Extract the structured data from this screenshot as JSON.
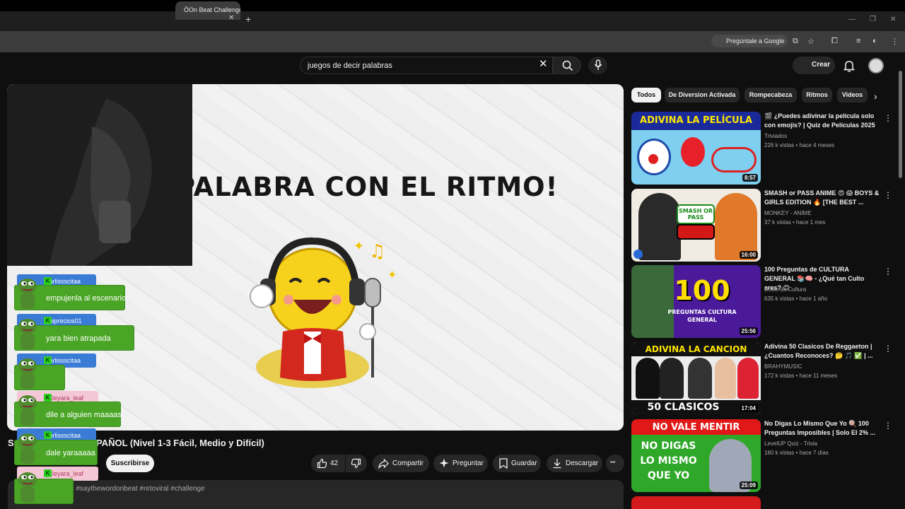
{
  "browser": {
    "tab_title": "ÖOn Beat Challenge",
    "tab_close": "✕",
    "new_tab": "+",
    "google_pill": "Pregúntale a Google"
  },
  "header": {
    "search_query": "juegos de decir palabras",
    "clear": "✕",
    "create_label": "Crear",
    "create_plus": "+"
  },
  "video": {
    "overlay_title": "¡DI LA PALABRA CON EL RITMO!",
    "title_visible": "S                     t Challenge EN ESPAÑOL (Nivel 1-3 Fácil, Medio y Difícil)",
    "subscribe_label": "Suscribirse",
    "likes": "42",
    "share_label": "Compartir",
    "ask_label": "Preguntar",
    "save_label": "Guardar",
    "download_label": "Descargar",
    "more": "•••",
    "description_tags": "as  #saythewordonbeat #retoviral #challenge"
  },
  "chat": [
    {
      "user": "karlissscitaa",
      "message": "empujenla al escenario",
      "name_color": "#3a7bd5",
      "name_text": "#ffffff"
    },
    {
      "user": "chiprecios01",
      "message": "yara bien atrapada",
      "name_color": "#3a7bd5",
      "name_text": "#ffffff"
    },
    {
      "user": "karlissscitaa",
      "message": "",
      "name_color": "#3a7bd5",
      "name_text": "#ffffff"
    },
    {
      "user": "littleyara_leaf",
      "message": "dile a alguien maaaas",
      "name_color": "#f4c7d6",
      "name_text": "#b04060"
    },
    {
      "user": "karlissscitaa",
      "message": "dale yaraaaaa",
      "name_color": "#3a7bd5",
      "name_text": "#ffffff"
    },
    {
      "user": "littleyara_leaf",
      "message": "",
      "name_color": "#f4c7d6",
      "name_text": "#b04060"
    }
  ],
  "chips": [
    "Todos",
    "De Diversion Activada",
    "Rompecabeza",
    "Ritmos",
    "Videos"
  ],
  "chip_next": "›",
  "recommendations": [
    {
      "title": "🎬 ¿Puedes adivinar la película solo con emojis? | Quiz de Películas 2025",
      "channel": "Triviados",
      "meta": "226 k vistas • hace 4 meses",
      "duration": "8:57",
      "thumb_text": "ADIVINA LA PELÍCULA"
    },
    {
      "title": "SMASH or PASS ANIME 😍 😱 BOYS & GIRLS EDITION 🔥 [THE BEST ...",
      "channel": "MONKEY - ANIME",
      "meta": "37 k vistas • hace 1 mes",
      "duration": "16:00",
      "thumb_text": "SMASH OR PASS"
    },
    {
      "title": "100 Preguntas de CULTURA GENERAL 📚🧠 - ¿Qué tan Culto eres? 😊",
      "channel": "Dosis de Cultura",
      "meta": "635 k vistas • hace 1 año",
      "duration": "25:56",
      "thumb_text": "100",
      "thumb_sub": "PREGUNTAS CULTURA GENERAL"
    },
    {
      "title": "Adivina 50 Clasicos De Reggaeton | ¿Cuantos Reconoces? 🤔 🎵 ✅ | ...",
      "channel": "BRAHYMUSIC",
      "meta": "172 k vistas • hace 11 meses",
      "duration": "17:04",
      "thumb_text": "ADIVINA LA CANCION",
      "thumb_sub": "50 CLASICOS"
    },
    {
      "title": "No Digas Lo Mismo Que Yo 🍭 100 Preguntas Imposibles | Solo El 2% ...",
      "channel": "LevelUP Quiz - Trivia",
      "meta": "160 k vistas • hace 7 días",
      "duration": "25:09",
      "thumb_text": "NO VALE MENTIR",
      "thumb_sub": "NO DIGAS LO MISMO QUE YO"
    }
  ],
  "rec_more": "⋮",
  "colors": {
    "background": "#0f0f0f",
    "chip_bg": "#272727",
    "chat_green": "#4aa526",
    "twitch_badge": "#2bd11f"
  }
}
